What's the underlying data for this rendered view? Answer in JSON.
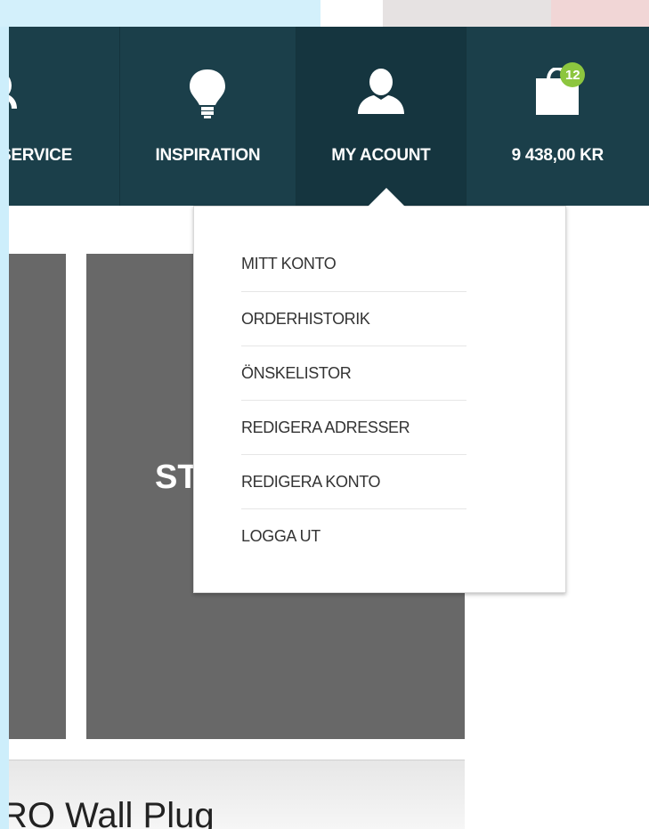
{
  "nav": {
    "items": [
      {
        "label": "SERVICE",
        "icon": "support-icon"
      },
      {
        "label": "INSPIRATION",
        "icon": "lightbulb-icon"
      },
      {
        "label": "MY ACOUNT",
        "icon": "user-icon"
      },
      {
        "label": "9 438,00 KR",
        "icon": "shopping-bag-icon",
        "badge": "12"
      }
    ]
  },
  "account_menu": {
    "items": [
      {
        "label": "MITT KONTO"
      },
      {
        "label": "ORDERHISTORIK"
      },
      {
        "label": "ÖNSKELISTOR"
      },
      {
        "label": "REDIGERA ADRESSER"
      },
      {
        "label": "REDIGERA KONTO"
      },
      {
        "label": "LOGGA UT"
      }
    ]
  },
  "content": {
    "tile_text": "ST",
    "caption": "RO Wall Plug"
  },
  "colors": {
    "nav_bg": "#1b3f4a",
    "badge": "#8dc63f",
    "tile": "#686868"
  }
}
